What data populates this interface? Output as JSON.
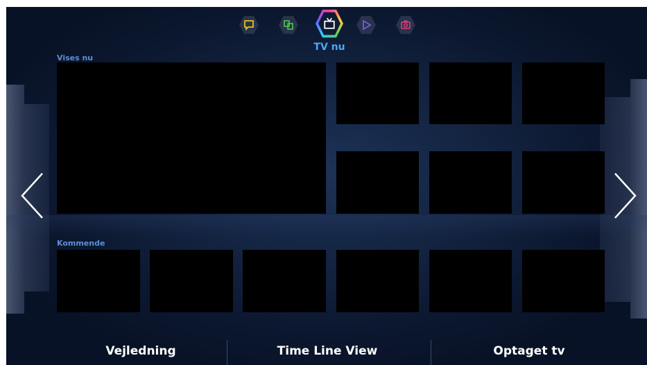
{
  "top_nav": {
    "items": [
      {
        "icon": "chat-icon",
        "color": "#e8c41a"
      },
      {
        "icon": "multiscreen-icon",
        "color": "#48c84a"
      },
      {
        "icon": "tv-icon",
        "color": "#ffffff",
        "active": true
      },
      {
        "icon": "play-icon",
        "color": "#8b5cf0"
      },
      {
        "icon": "camera-icon",
        "color": "#e0407a"
      }
    ],
    "active_label": "TV nu"
  },
  "sections": {
    "now_showing_label": "Vises nu",
    "upcoming_label": "Kommende"
  },
  "navigation": {
    "left_icon": "chevron-left-icon",
    "right_icon": "chevron-right-icon"
  },
  "bottom_menu": {
    "items": [
      "Vejledning",
      "Time Line View",
      "Optaget tv"
    ]
  },
  "colors": {
    "accent": "#4aa8ff",
    "section_label": "#5b8fd6",
    "background": "#0c1830"
  }
}
